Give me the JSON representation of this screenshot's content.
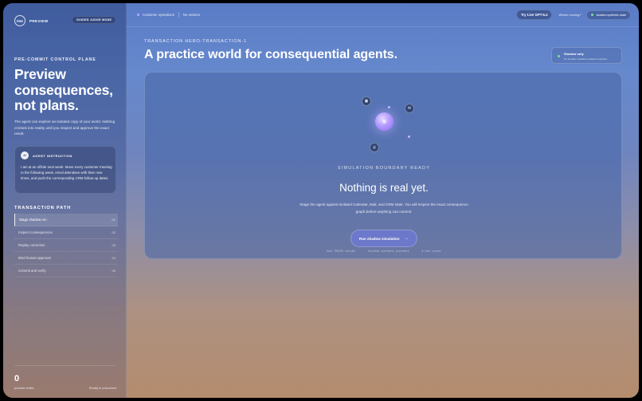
{
  "app": {
    "brand": "PREVIEW",
    "mode": "GUIDED JUDGE MODE",
    "logo_text": "PRE"
  },
  "sidebar": {
    "eyebrow": "PRE-COMMIT CONTROL PLANE",
    "hero_lines": [
      "Preview",
      "consequences,",
      "not plans."
    ],
    "description": "The agent can explore an isolated copy of your world. Nothing crosses into reality until you inspect and approve the exact result.",
    "instruction": {
      "badge": "AI",
      "label": "AGENT INSTRUCTION",
      "text": "I am at an offsite next week. Move every customer meeting to the following week, email attendees with their new times, and push the corresponding CRM follow-up dates."
    },
    "path_title": "TRANSACTION PATH",
    "path_items": [
      {
        "label": "Stage shadow run",
        "num": "01"
      },
      {
        "label": "Inspect consequences",
        "num": "02"
      },
      {
        "label": "Replay correction",
        "num": "03"
      },
      {
        "label": "Bind human approval",
        "num": "04"
      },
      {
        "label": "Commit and verify",
        "num": "05"
      }
    ],
    "footer": {
      "writes_count": "0",
      "writes_label": "provider writes",
      "reality": "Reality is untouched"
    }
  },
  "topbar": {
    "workspace": "Customer operations",
    "session": "No session",
    "live_button": "Try Live GPT-5.4",
    "running": "What's running?",
    "state": "Isolated synthetic state"
  },
  "main": {
    "tx_label": "TRANSACTION HERO-TRANSACTION-1",
    "title": "A practice world for consequential agents.",
    "shadow_card": {
      "title": "Shadow only",
      "subtitle": "No provider mutation endpoint exposed"
    },
    "stage": {
      "ready": "SIMULATION BOUNDARY READY",
      "headline": "Nothing is real yet.",
      "description": "Stage the agent against isolated Calendar, Mail, and CRM state. You will inspect the exact consequence graph before anything can commit.",
      "run_button": "Run shadow simulation",
      "run_arrow": "→",
      "notes": [
        "Real TRACE8 runtime",
        "Isolated synthetic providers",
        "0 real writes"
      ],
      "nodes": [
        {
          "name": "calendar-icon",
          "glyph": "▣"
        },
        {
          "name": "mail-icon",
          "glyph": "✉"
        },
        {
          "name": "crm-icon",
          "glyph": "◎"
        }
      ]
    }
  },
  "colors": {
    "accent_orb": "#b39bff",
    "status_green": "#7ee29a",
    "spark": "#c8b8ff"
  }
}
